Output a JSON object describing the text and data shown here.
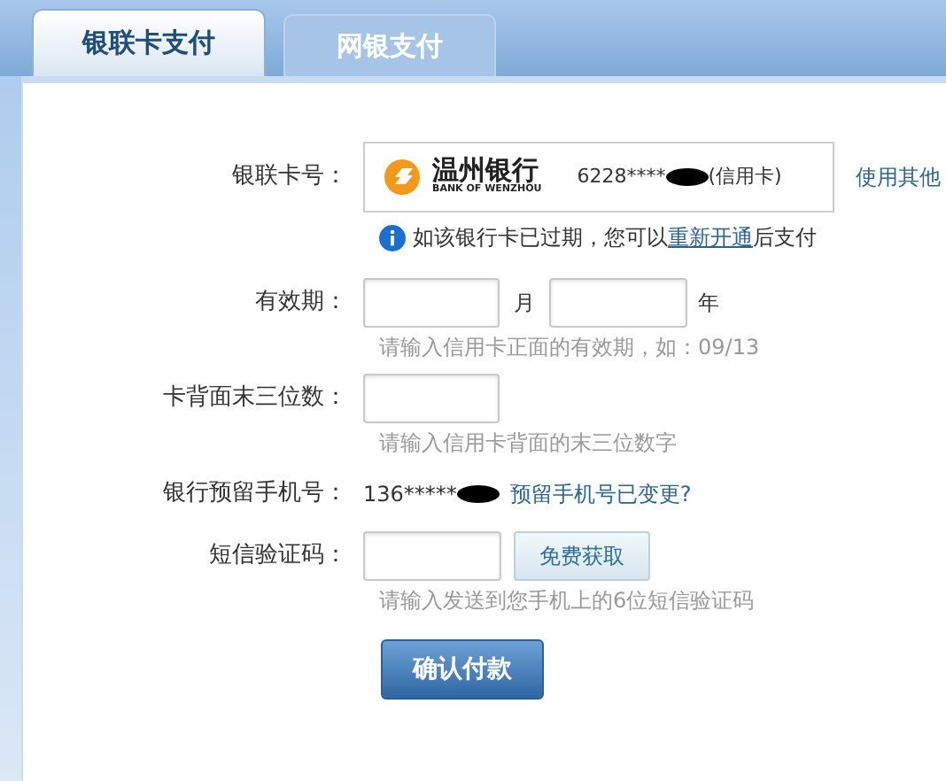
{
  "tabs": [
    {
      "label": "银联卡支付",
      "selected": true
    },
    {
      "label": "网银支付",
      "selected": false
    }
  ],
  "card": {
    "label": "银联卡号：",
    "bank_name": "温州银行",
    "bank_name_en": "BANK OF WENZHOU",
    "number": "6228****",
    "type": "(信用卡)",
    "other_card_link": "使用其他"
  },
  "notice": {
    "before": "如该银行卡已过期，您可以",
    "link": "重新开通",
    "after": "后支付"
  },
  "expiry": {
    "label": "有效期：",
    "month_unit": "月",
    "year_unit": "年",
    "hint": "请输入信用卡正面的有效期，如：09/13"
  },
  "cvv": {
    "label": "卡背面末三位数：",
    "hint": "请输入信用卡背面的末三位数字"
  },
  "phone": {
    "label": "银行预留手机号：",
    "number": "136*****",
    "change_link": "预留手机号已变更?"
  },
  "sms": {
    "label": "短信验证码：",
    "get_code_button": "免费获取",
    "hint": "请输入发送到您手机上的6位短信验证码"
  },
  "confirm_button": "确认付款"
}
